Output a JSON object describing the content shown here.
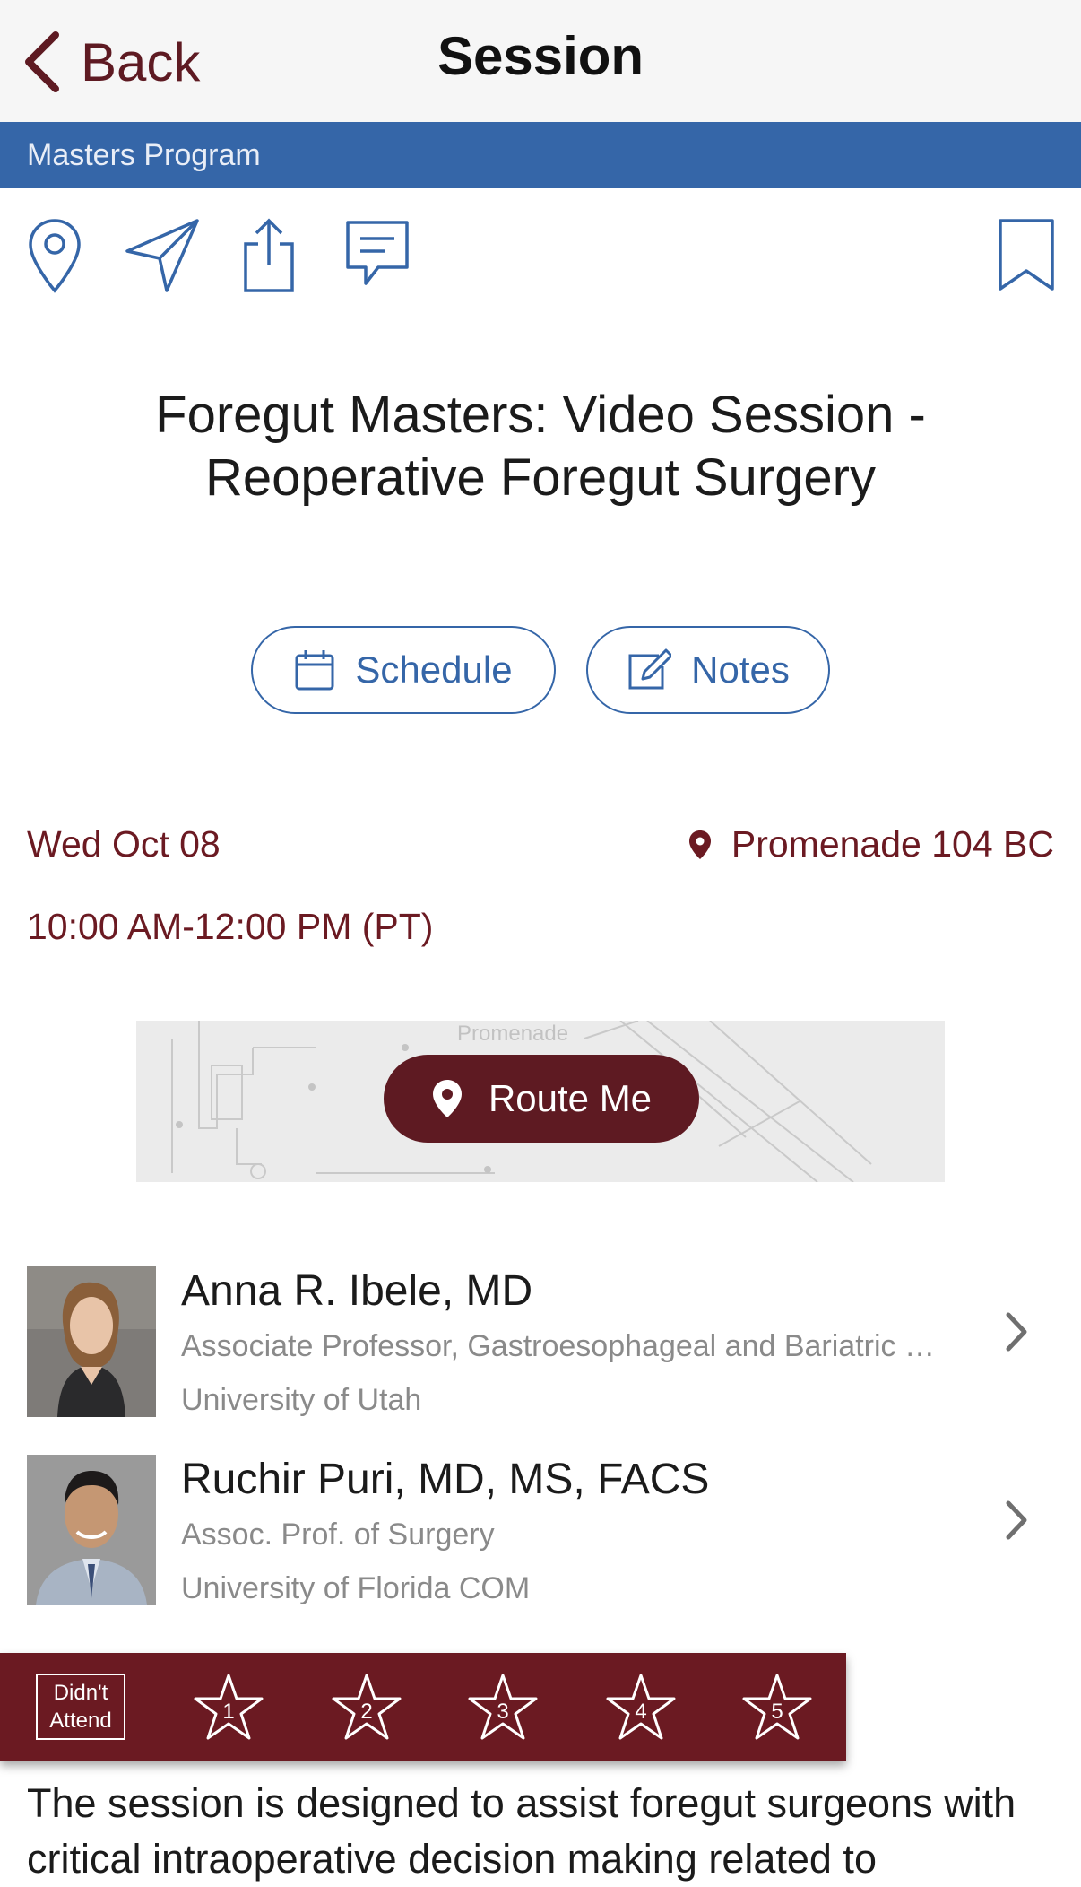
{
  "nav": {
    "back_label": "Back",
    "title": "Session"
  },
  "track": {
    "label": "Masters Program"
  },
  "actions": {
    "icons": [
      "map-pin-icon",
      "navigate-icon",
      "share-icon",
      "comment-icon",
      "bookmark-icon"
    ]
  },
  "session": {
    "title": "Foregut Masters: Video Session - Reoperative Foregut Surgery",
    "date": "Wed Oct 08",
    "time": "10:00 AM-12:00 PM (PT)",
    "location": "Promenade 104 BC"
  },
  "buttons": {
    "schedule": "Schedule",
    "notes": "Notes",
    "route_me": "Route Me"
  },
  "map": {
    "label": "Promenade"
  },
  "speakers": [
    {
      "name": "Anna R. Ibele, MD",
      "role": "Associate Professor, Gastroesophageal and Bariatric Surgery",
      "org": "University of Utah"
    },
    {
      "name": "Ruchir Puri, MD, MS, FACS",
      "role": "Assoc. Prof. of Surgery",
      "org": "University of Florida COM"
    }
  ],
  "rating": {
    "didnt_attend": "Didn't Attend",
    "stars": [
      "1",
      "2",
      "3",
      "4",
      "5"
    ]
  },
  "description": "The session is designed to assist foregut surgeons with critical intraoperative decision making related to",
  "colors": {
    "maroon": "#6b1a22",
    "blue": "#3566a8",
    "nav_bg": "#f6f6f6"
  }
}
